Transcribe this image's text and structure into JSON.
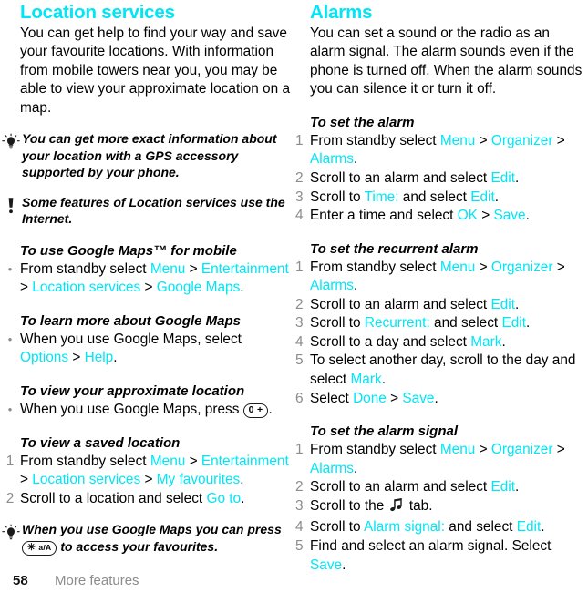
{
  "page": {
    "number": "58",
    "chapter": "More features",
    "accent_color": "#00e6f6",
    "marker_color": "#8c8c8c"
  },
  "left_column": {
    "title": "Location services",
    "intro": "You can get help to find your way and save your favourite locations. With information from mobile towers near you, you may be able to view your approximate location on a map.",
    "callouts": [
      {
        "icon": "lightbulb-tip-icon",
        "text": "You can get more exact information about your location with a GPS accessory supported by your phone."
      },
      {
        "icon": "exclamation-note-icon",
        "text": "Some features of Location services use the Internet."
      }
    ],
    "procedures": [
      {
        "title": "To use Google Maps™ for mobile",
        "list_type": "bullet",
        "steps": [
          {
            "marker": "•",
            "parts": [
              {
                "t": "From standby select ",
                "hl": false
              },
              {
                "t": "Menu",
                "hl": true
              },
              {
                "t": " > ",
                "hl": false
              },
              {
                "t": "Entertainment",
                "hl": true
              },
              {
                "t": " > ",
                "hl": false
              },
              {
                "t": "Location services",
                "hl": true
              },
              {
                "t": " > ",
                "hl": false
              },
              {
                "t": "Google Maps",
                "hl": true
              },
              {
                "t": ".",
                "hl": false
              }
            ]
          }
        ]
      },
      {
        "title": "To learn more about Google Maps",
        "list_type": "bullet",
        "steps": [
          {
            "marker": "•",
            "parts": [
              {
                "t": "When you use Google Maps, select ",
                "hl": false
              },
              {
                "t": "Options",
                "hl": true
              },
              {
                "t": " > ",
                "hl": false
              },
              {
                "t": "Help",
                "hl": true
              },
              {
                "t": ".",
                "hl": false
              }
            ]
          }
        ]
      },
      {
        "title": "To view your approximate location",
        "list_type": "bullet",
        "steps": [
          {
            "marker": "•",
            "parts": [
              {
                "t": "When you use Google Maps, press ",
                "hl": false
              },
              {
                "t": "0 +",
                "key": true
              },
              {
                "t": ".",
                "hl": false
              }
            ]
          }
        ]
      },
      {
        "title": "To view a saved location",
        "list_type": "number",
        "steps": [
          {
            "marker": "1",
            "parts": [
              {
                "t": "From standby select ",
                "hl": false
              },
              {
                "t": "Menu",
                "hl": true
              },
              {
                "t": " > ",
                "hl": false
              },
              {
                "t": "Entertainment",
                "hl": true
              },
              {
                "t": " > ",
                "hl": false
              },
              {
                "t": "Location services",
                "hl": true
              },
              {
                "t": " > ",
                "hl": false
              },
              {
                "t": "My favourites",
                "hl": true
              },
              {
                "t": ".",
                "hl": false
              }
            ]
          },
          {
            "marker": "2",
            "parts": [
              {
                "t": "Scroll to a location and select ",
                "hl": false
              },
              {
                "t": "Go to",
                "hl": true
              },
              {
                "t": ".",
                "hl": false
              }
            ]
          }
        ]
      }
    ],
    "footer_callout": {
      "icon": "lightbulb-tip-icon",
      "parts": [
        {
          "t": "When you use Google Maps you can press ",
          "hl": false
        },
        {
          "t": "✳ a/A",
          "key": true
        },
        {
          "t": " to access your favourites.",
          "hl": false
        }
      ]
    }
  },
  "right_column": {
    "title": "Alarms",
    "intro": "You can set a sound or the radio as an alarm signal. The alarm sounds even if the phone is turned off. When the alarm sounds you can silence it or turn it off.",
    "procedures": [
      {
        "title": "To set the alarm",
        "steps": [
          {
            "marker": "1",
            "parts": [
              {
                "t": "From standby select ",
                "hl": false
              },
              {
                "t": "Menu",
                "hl": true
              },
              {
                "t": " > ",
                "hl": false
              },
              {
                "t": "Organizer",
                "hl": true
              },
              {
                "t": " > ",
                "hl": false
              },
              {
                "t": "Alarms",
                "hl": true
              },
              {
                "t": ".",
                "hl": false
              }
            ]
          },
          {
            "marker": "2",
            "parts": [
              {
                "t": "Scroll to an alarm and select ",
                "hl": false
              },
              {
                "t": "Edit",
                "hl": true
              },
              {
                "t": ".",
                "hl": false
              }
            ]
          },
          {
            "marker": "3",
            "parts": [
              {
                "t": "Scroll to ",
                "hl": false
              },
              {
                "t": "Time:",
                "hl": true
              },
              {
                "t": " and select ",
                "hl": false
              },
              {
                "t": "Edit",
                "hl": true
              },
              {
                "t": ".",
                "hl": false
              }
            ]
          },
          {
            "marker": "4",
            "parts": [
              {
                "t": "Enter a time and select ",
                "hl": false
              },
              {
                "t": "OK",
                "hl": true
              },
              {
                "t": " > ",
                "hl": false
              },
              {
                "t": "Save",
                "hl": true
              },
              {
                "t": ".",
                "hl": false
              }
            ]
          }
        ]
      },
      {
        "title": "To set the recurrent alarm",
        "steps": [
          {
            "marker": "1",
            "parts": [
              {
                "t": "From standby select ",
                "hl": false
              },
              {
                "t": "Menu",
                "hl": true
              },
              {
                "t": " > ",
                "hl": false
              },
              {
                "t": "Organizer",
                "hl": true
              },
              {
                "t": " > ",
                "hl": false
              },
              {
                "t": "Alarms",
                "hl": true
              },
              {
                "t": ".",
                "hl": false
              }
            ]
          },
          {
            "marker": "2",
            "parts": [
              {
                "t": "Scroll to an alarm and select ",
                "hl": false
              },
              {
                "t": "Edit",
                "hl": true
              },
              {
                "t": ".",
                "hl": false
              }
            ]
          },
          {
            "marker": "3",
            "parts": [
              {
                "t": "Scroll to ",
                "hl": false
              },
              {
                "t": "Recurrent:",
                "hl": true
              },
              {
                "t": " and select ",
                "hl": false
              },
              {
                "t": "Edit",
                "hl": true
              },
              {
                "t": ".",
                "hl": false
              }
            ]
          },
          {
            "marker": "4",
            "parts": [
              {
                "t": "Scroll to a day and select ",
                "hl": false
              },
              {
                "t": "Mark",
                "hl": true
              },
              {
                "t": ".",
                "hl": false
              }
            ]
          },
          {
            "marker": "5",
            "parts": [
              {
                "t": "To select another day, scroll to the day and select ",
                "hl": false
              },
              {
                "t": "Mark",
                "hl": true
              },
              {
                "t": ".",
                "hl": false
              }
            ]
          },
          {
            "marker": "6",
            "parts": [
              {
                "t": "Select ",
                "hl": false
              },
              {
                "t": "Done",
                "hl": true
              },
              {
                "t": " > ",
                "hl": false
              },
              {
                "t": "Save",
                "hl": true
              },
              {
                "t": ".",
                "hl": false
              }
            ]
          }
        ]
      },
      {
        "title": "To set the alarm signal",
        "steps": [
          {
            "marker": "1",
            "parts": [
              {
                "t": "From standby select ",
                "hl": false
              },
              {
                "t": "Menu",
                "hl": true
              },
              {
                "t": " > ",
                "hl": false
              },
              {
                "t": "Organizer",
                "hl": true
              },
              {
                "t": " > ",
                "hl": false
              },
              {
                "t": "Alarms",
                "hl": true
              },
              {
                "t": ".",
                "hl": false
              }
            ]
          },
          {
            "marker": "2",
            "parts": [
              {
                "t": "Scroll to an alarm and select ",
                "hl": false
              },
              {
                "t": "Edit",
                "hl": true
              },
              {
                "t": ".",
                "hl": false
              }
            ]
          },
          {
            "marker": "3",
            "parts": [
              {
                "t": "Scroll to the ",
                "hl": false
              },
              {
                "t": "♫",
                "glyph": "music-note-icon"
              },
              {
                "t": " tab.",
                "hl": false
              }
            ]
          },
          {
            "marker": "4",
            "parts": [
              {
                "t": "Scroll to ",
                "hl": false
              },
              {
                "t": "Alarm signal:",
                "hl": true
              },
              {
                "t": " and select ",
                "hl": false
              },
              {
                "t": "Edit",
                "hl": true
              },
              {
                "t": ".",
                "hl": false
              }
            ]
          },
          {
            "marker": "5",
            "parts": [
              {
                "t": "Find and select an alarm signal. Select ",
                "hl": false
              },
              {
                "t": "Save",
                "hl": true
              },
              {
                "t": ".",
                "hl": false
              }
            ]
          }
        ]
      }
    ]
  }
}
